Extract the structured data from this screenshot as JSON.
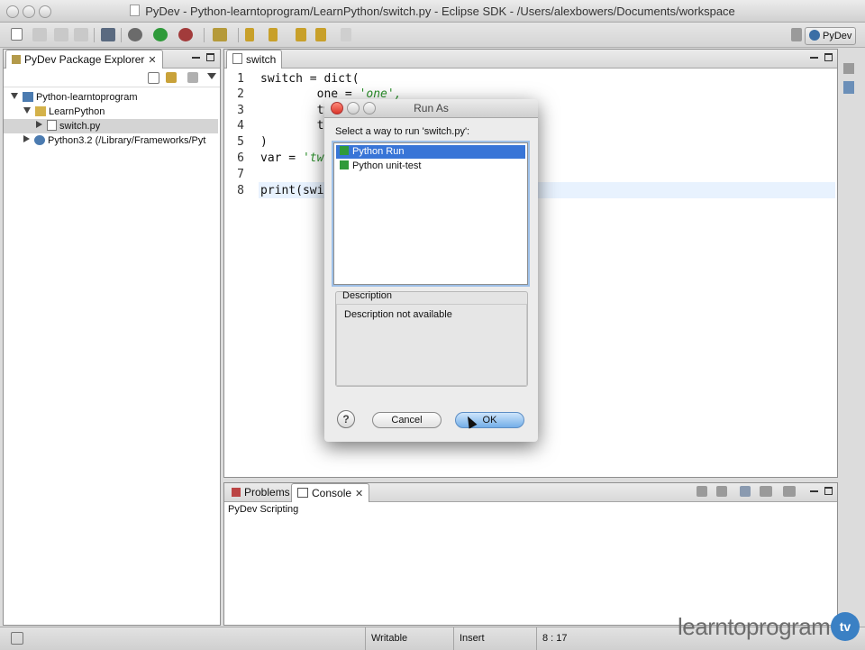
{
  "window": {
    "title": "PyDev - Python-learntoprogram/LearnPython/switch.py - Eclipse SDK - /Users/alexbowers/Documents/workspace"
  },
  "toolbar": {
    "perspective_label": "PyDev"
  },
  "explorer": {
    "tab_label": "PyDev Package Explorer",
    "tree": [
      {
        "label": "Python-learntoprogram",
        "expanded": true
      },
      {
        "label": "LearnPython",
        "expanded": true
      },
      {
        "label": "switch.py",
        "selected": true
      },
      {
        "label": "Python3.2  (/Library/Frameworks/Pyt",
        "expanded": false
      }
    ]
  },
  "editor": {
    "tab_label": "switch",
    "lines": [
      {
        "num": "1",
        "text": "switch = dict("
      },
      {
        "num": "2",
        "text": "        one = ",
        "str": "'one',"
      },
      {
        "num": "3",
        "text": "        tw"
      },
      {
        "num": "4",
        "text": "        th"
      },
      {
        "num": "5",
        "text": ")"
      },
      {
        "num": "6",
        "text": "var = ",
        "str": "'tw"
      },
      {
        "num": "7",
        "text": ""
      },
      {
        "num": "8",
        "text": "print(swit"
      }
    ]
  },
  "dialog": {
    "title": "Run As",
    "prompt": "Select a way to run 'switch.py':",
    "options": [
      {
        "label": "Python Run",
        "selected": true
      },
      {
        "label": "Python unit-test",
        "selected": false
      }
    ],
    "description_label": "Description",
    "description_text": "Description not available",
    "help_icon": "?",
    "cancel_label": "Cancel",
    "ok_label": "OK"
  },
  "console_panel": {
    "tabs": [
      {
        "label": "Problems"
      },
      {
        "label": "Console",
        "active": true
      }
    ],
    "header": "PyDev Scripting"
  },
  "statusbar": {
    "writable": "Writable",
    "insert": "Insert",
    "position": "8 : 17"
  },
  "brand": {
    "text": "learntoprogram",
    "badge": "tv"
  },
  "colors": {
    "selection": "#3875d7",
    "string": "#2a8f2a",
    "current_line": "#e8f2fe"
  }
}
